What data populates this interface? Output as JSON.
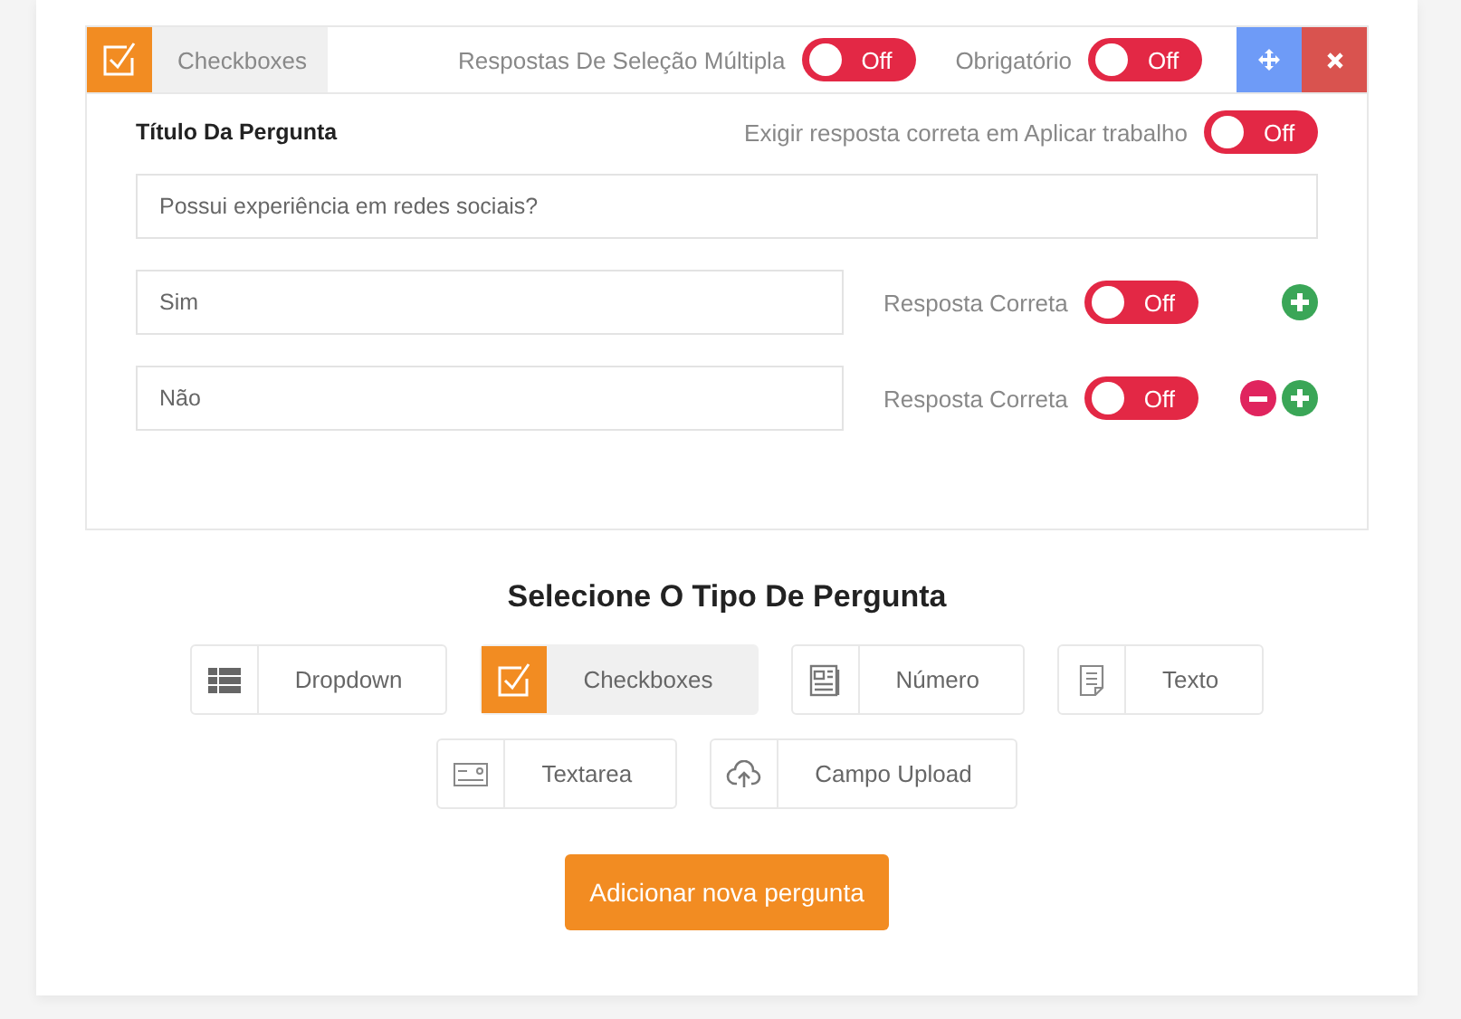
{
  "header": {
    "type_label": "Checkboxes",
    "multiple": {
      "label": "Respostas De Seleção Múltipla",
      "toggle": "Off",
      "on": false
    },
    "required": {
      "label": "Obrigatório",
      "toggle": "Off",
      "on": false
    }
  },
  "question": {
    "label": "Título Da Pergunta",
    "require_correct": {
      "label": "Exigir resposta correta em Aplicar trabalho",
      "toggle": "Off",
      "on": false
    },
    "value": "Possui experiência em redes sociais?"
  },
  "answers": [
    {
      "value": "Sim",
      "correct_label": "Resposta Correta",
      "toggle": "Off",
      "on": false,
      "removable": false
    },
    {
      "value": "Não",
      "correct_label": "Resposta Correta",
      "toggle": "Off",
      "on": false,
      "removable": true
    }
  ],
  "type_picker": {
    "title": "Selecione O Tipo De Pergunta",
    "options": [
      {
        "kind": "dropdown",
        "label": "Dropdown",
        "selected": false
      },
      {
        "kind": "checkboxes",
        "label": "Checkboxes",
        "selected": true
      },
      {
        "kind": "number",
        "label": "Número",
        "selected": false
      },
      {
        "kind": "text",
        "label": "Texto",
        "selected": false
      },
      {
        "kind": "textarea",
        "label": "Textarea",
        "selected": false
      },
      {
        "kind": "upload",
        "label": "Campo Upload",
        "selected": false
      }
    ]
  },
  "add_button": "Adicionar nova pergunta"
}
